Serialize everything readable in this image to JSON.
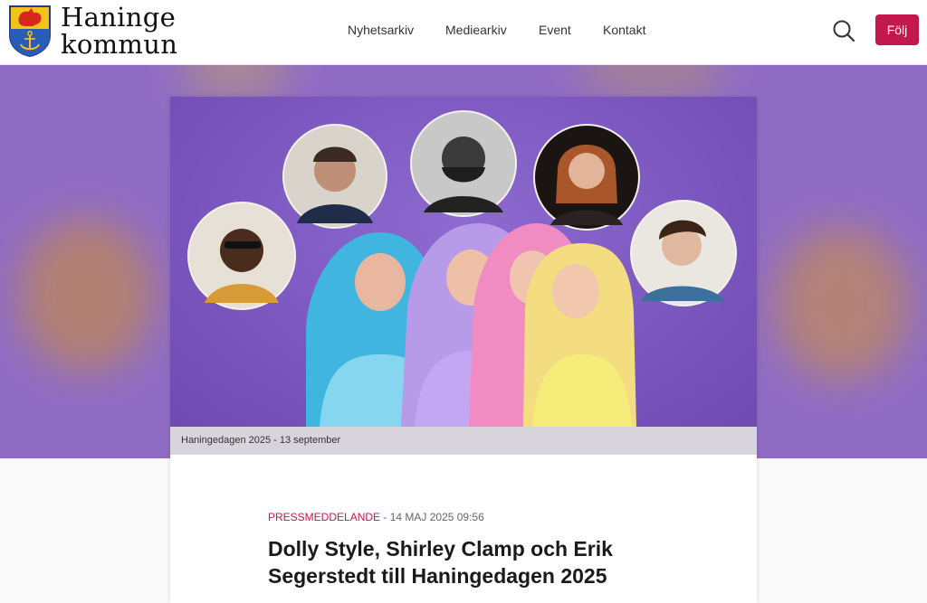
{
  "header": {
    "logo": {
      "line1": "Haninge",
      "line2": "kommun"
    },
    "nav": [
      "Nyhetsarkiv",
      "Mediearkiv",
      "Event",
      "Kontakt"
    ],
    "follow_label": "Följ"
  },
  "hero": {
    "caption": "Haningedagen 2025 - 13 september"
  },
  "article": {
    "type": "PRESSMEDDELANDE",
    "separator": " - ",
    "date": "14 MAJ 2025 09:56",
    "title": "Dolly Style, Shirley Clamp och Erik Segerstedt till Haningedagen 2025"
  },
  "colors": {
    "accent": "#c3174d",
    "hero_purple": "#8f6cc4"
  },
  "icons": [
    "coat-of-arms-icon",
    "search-icon"
  ]
}
